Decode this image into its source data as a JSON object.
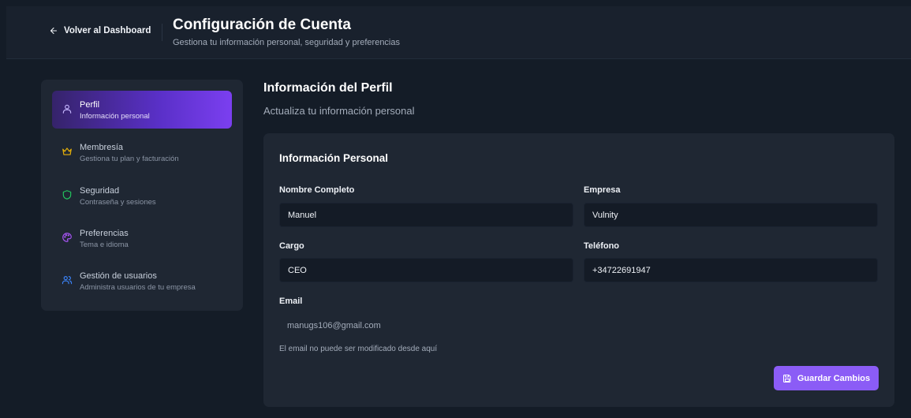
{
  "header": {
    "back_label": "Volver al Dashboard",
    "title": "Configuración de Cuenta",
    "subtitle": "Gestiona tu información personal, seguridad y preferencias"
  },
  "sidebar": {
    "items": [
      {
        "label": "Perfil",
        "sub": "Información personal",
        "icon": "user-icon",
        "active": true
      },
      {
        "label": "Membresía",
        "sub": "Gestiona tu plan y facturación",
        "icon": "crown-icon",
        "active": false
      },
      {
        "label": "Seguridad",
        "sub": "Contraseña y sesiones",
        "icon": "shield-icon",
        "active": false
      },
      {
        "label": "Preferencias",
        "sub": "Tema e idioma",
        "icon": "palette-icon",
        "active": false
      },
      {
        "label": "Gestión de usuarios",
        "sub": "Administra usuarios de tu empresa",
        "icon": "users-icon",
        "active": false
      }
    ]
  },
  "main": {
    "title": "Información del Perfil",
    "subtitle": "Actualiza tu información personal",
    "card": {
      "title": "Información Personal",
      "fields": {
        "name": {
          "label": "Nombre Completo",
          "value": "Manuel"
        },
        "company": {
          "label": "Empresa",
          "value": "Vulnity"
        },
        "position": {
          "label": "Cargo",
          "value": "CEO"
        },
        "phone": {
          "label": "Teléfono",
          "value": "+34722691947"
        },
        "email": {
          "label": "Email",
          "value": "manugs106@gmail.com",
          "hint": "El email no puede ser modificado desde aquí"
        }
      },
      "save_label": "Guardar Cambios"
    }
  },
  "colors": {
    "background": "#141c27",
    "panel": "#1f2733",
    "accent": "#8b5cf6",
    "crown": "#eab308",
    "shield": "#22c55e",
    "palette": "#a855f7",
    "users": "#3b82f6"
  }
}
